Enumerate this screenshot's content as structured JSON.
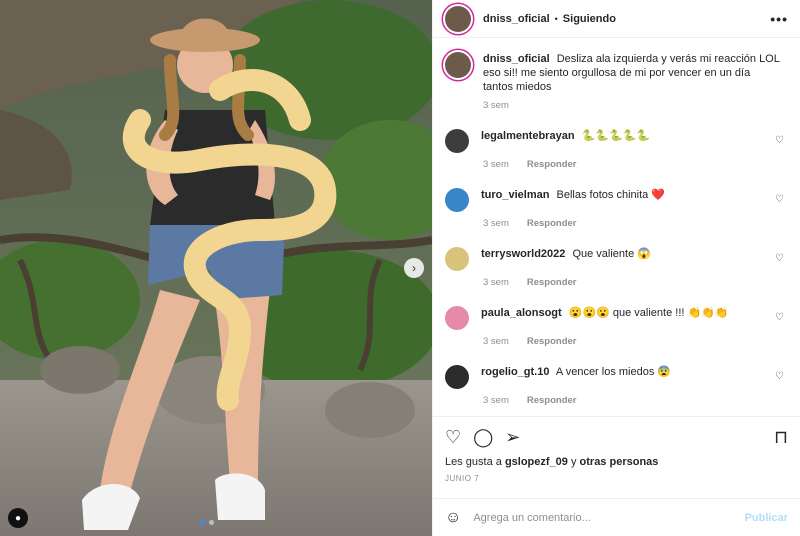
{
  "header": {
    "username": "dniss_oficial",
    "separator": "•",
    "follow_status": "Siguiendo",
    "more": "•••"
  },
  "caption": {
    "username": "dniss_oficial",
    "text": "Desliza ala izquierda y verás mi reacción LOL eso si!! me siento orgullosa de mi por vencer en un día tantos miedos",
    "time": "3 sem"
  },
  "comments": [
    {
      "username": "legalmentebrayan",
      "text": "🐍🐍🐍🐍🐍",
      "time": "3 sem",
      "reply": "Responder",
      "avatar_color": "#3d3d3d"
    },
    {
      "username": "turo_vielman",
      "text": "Bellas fotos chinita ❤️",
      "time": "3 sem",
      "reply": "Responder",
      "avatar_color": "#3a86c8"
    },
    {
      "username": "terrysworld2022",
      "text": "Que valiente 😱",
      "time": "3 sem",
      "reply": "Responder",
      "avatar_color": "#d9c27a"
    },
    {
      "username": "paula_alonsogt",
      "text": "😮😮😮 que valiente !!! 👏👏👏",
      "time": "3 sem",
      "reply": "Responder",
      "avatar_color": "#e58aa8"
    },
    {
      "username": "rogelio_gt.10",
      "text": "A vencer los miedos 😨",
      "time": "3 sem",
      "reply": "Responder",
      "avatar_color": "#2c2c2c"
    }
  ],
  "actions": {
    "likes_prefix": "Les gusta a",
    "likes_user": "gslopezf_09",
    "likes_connector": "y",
    "likes_others": "otras personas",
    "date": "JUNIO 7"
  },
  "add_comment": {
    "placeholder": "Agrega un comentario...",
    "publish": "Publicar"
  },
  "colors": {
    "publish_disabled": "#b2dffc",
    "carousel_active": "#3b8bf0",
    "story_ring": "#d6249f"
  },
  "icons": [
    "heart-icon",
    "comment-icon",
    "share-icon",
    "bookmark-icon",
    "emoji-icon",
    "user-tag-icon",
    "chevron-right-icon",
    "more-icon"
  ]
}
